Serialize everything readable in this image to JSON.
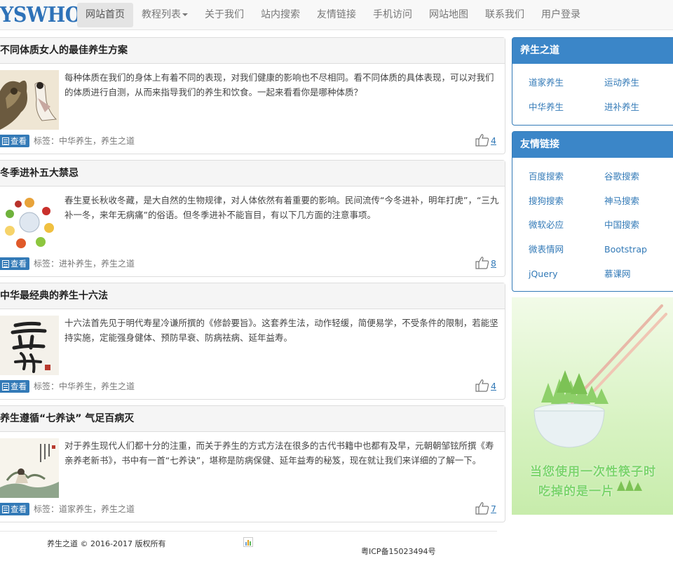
{
  "brand": "YSWHO",
  "nav": {
    "items": [
      "网站首页",
      "教程列表",
      "关于我们",
      "站内搜索",
      "友情链接",
      "手机访问",
      "网站地图",
      "联系我们",
      "用户登录"
    ]
  },
  "articles": [
    {
      "title": "不同体质女人的最佳养生方案",
      "excerpt": "每种体质在我们的身体上有着不同的表现，对我们健康的影响也不尽相同。看不同体质的具体表现，可以对我们的体质进行自测，从而来指导我们的养生和饮食。一起来看看你是哪种体质？",
      "view_label": "查看",
      "tags_label": "标签：",
      "tags": [
        "中华养生",
        "养生之道"
      ],
      "likes": "4"
    },
    {
      "title": "冬季进补五大禁忌",
      "excerpt": "春生夏长秋收冬藏，是大自然的生物规律，对人体依然有着重要的影响。民间流传“今冬进补，明年打虎”，“三九补一冬，来年无病痛”的俗语。但冬季进补不能盲目，有以下几方面的注意事项。",
      "view_label": "查看",
      "tags_label": "标签：",
      "tags": [
        "进补养生",
        "养生之道"
      ],
      "likes": "8"
    },
    {
      "title": "中华最经典的养生十六法",
      "excerpt": "十六法首先见于明代寿星冷谦所撰的《修龄要旨》。这套养生法，动作轻缓，简便易学，不受条件的限制，若能坚持实施，定能强身健体、预防早衰、防病祛病、延年益寿。",
      "view_label": "查看",
      "tags_label": "标签：",
      "tags": [
        "中华养生",
        "养生之道"
      ],
      "likes": "4"
    },
    {
      "title": "养生遵循“七养诀” 气足百病灭",
      "excerpt": "对于养生现代人们都十分的注重，而关于养生的方式方法在很多的古代书籍中也都有及早，元朝朝邹铉所撰《寿亲养老新书》，书中有一首“七养诀”，堪称是防病保健、延年益寿的秘笈，现在就让我们来详细的了解一下。",
      "view_label": "查看",
      "tags_label": "标签：",
      "tags": [
        "道家养生",
        "养生之道"
      ],
      "likes": "7"
    }
  ],
  "sidebar": {
    "health": {
      "title": "养生之道",
      "links": [
        "道家养生",
        "运动养生",
        "中华养生",
        "进补养生"
      ]
    },
    "friends": {
      "title": "友情链接",
      "links": [
        "百度搜索",
        "谷歌搜索",
        "搜狗搜索",
        "神马搜索",
        "微软必应",
        "中国搜索",
        "微表情网",
        "Bootstrap",
        "jQuery",
        "慕课网"
      ]
    },
    "ad": {
      "line1": "当您使用一次性筷子时",
      "line2": "吃掉的是一片"
    }
  },
  "footer": {
    "copyright": "养生之道 © 2016-2017 版权所有",
    "icp": "粤ICP备15023494号"
  },
  "colors": {
    "brand": "#2e72b8",
    "primary": "#337ab7",
    "panel_header": "#3b86c8",
    "ad_text": "#7bd46a"
  }
}
